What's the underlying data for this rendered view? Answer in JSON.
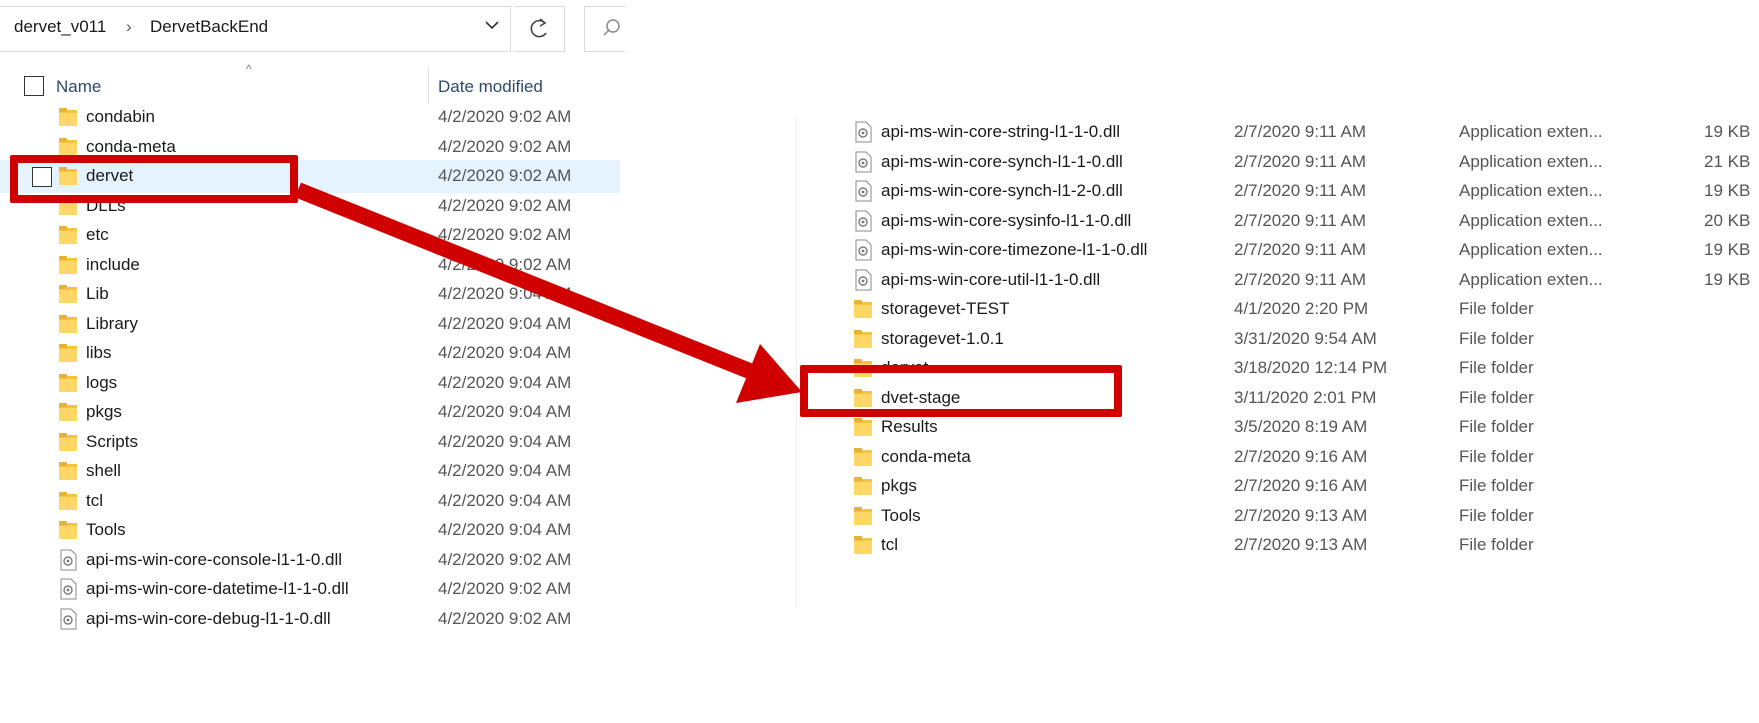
{
  "left": {
    "breadcrumb": [
      "dervet_v011",
      "DervetBackEnd"
    ],
    "breadcrumb_sep": "›",
    "search_icon_glyph": "⚲",
    "refresh_glyph": "↻",
    "dropdown_glyph": "⌄",
    "columns": {
      "name": "Name",
      "date": "Date modified"
    },
    "sort_glyph": "^",
    "rows": [
      {
        "name": "condabin",
        "date": "4/2/2020 9:02 AM",
        "icon": "folder-icon"
      },
      {
        "name": "conda-meta",
        "date": "4/2/2020 9:02 AM",
        "icon": "folder-icon"
      },
      {
        "name": "dervet",
        "date": "4/2/2020 9:02 AM",
        "icon": "folder-icon",
        "selected": true
      },
      {
        "name": "DLLs",
        "date": "4/2/2020 9:02 AM",
        "icon": "folder-icon"
      },
      {
        "name": "etc",
        "date": "4/2/2020 9:02 AM",
        "icon": "folder-icon"
      },
      {
        "name": "include",
        "date": "4/2/2020 9:02 AM",
        "icon": "folder-icon"
      },
      {
        "name": "Lib",
        "date": "4/2/2020 9:04 AM",
        "icon": "folder-icon"
      },
      {
        "name": "Library",
        "date": "4/2/2020 9:04 AM",
        "icon": "folder-icon"
      },
      {
        "name": "libs",
        "date": "4/2/2020 9:04 AM",
        "icon": "folder-icon"
      },
      {
        "name": "logs",
        "date": "4/2/2020 9:04 AM",
        "icon": "folder-icon"
      },
      {
        "name": "pkgs",
        "date": "4/2/2020 9:04 AM",
        "icon": "folder-icon"
      },
      {
        "name": "Scripts",
        "date": "4/2/2020 9:04 AM",
        "icon": "folder-icon"
      },
      {
        "name": "shell",
        "date": "4/2/2020 9:04 AM",
        "icon": "folder-icon"
      },
      {
        "name": "tcl",
        "date": "4/2/2020 9:04 AM",
        "icon": "folder-icon"
      },
      {
        "name": "Tools",
        "date": "4/2/2020 9:04 AM",
        "icon": "folder-icon"
      },
      {
        "name": "api-ms-win-core-console-l1-1-0.dll",
        "date": "4/2/2020 9:02 AM",
        "icon": "dll-file-icon"
      },
      {
        "name": "api-ms-win-core-datetime-l1-1-0.dll",
        "date": "4/2/2020 9:02 AM",
        "icon": "dll-file-icon"
      },
      {
        "name": "api-ms-win-core-debug-l1-1-0.dll",
        "date": "4/2/2020 9:02 AM",
        "icon": "dll-file-icon"
      }
    ]
  },
  "right": {
    "rows": [
      {
        "name": "api-ms-win-core-string-l1-1-0.dll",
        "date": "2/7/2020 9:11 AM",
        "type": "Application exten...",
        "size": "19 KB",
        "icon": "dll-file-icon"
      },
      {
        "name": "api-ms-win-core-synch-l1-1-0.dll",
        "date": "2/7/2020 9:11 AM",
        "type": "Application exten...",
        "size": "21 KB",
        "icon": "dll-file-icon"
      },
      {
        "name": "api-ms-win-core-synch-l1-2-0.dll",
        "date": "2/7/2020 9:11 AM",
        "type": "Application exten...",
        "size": "19 KB",
        "icon": "dll-file-icon"
      },
      {
        "name": "api-ms-win-core-sysinfo-l1-1-0.dll",
        "date": "2/7/2020 9:11 AM",
        "type": "Application exten...",
        "size": "20 KB",
        "icon": "dll-file-icon"
      },
      {
        "name": "api-ms-win-core-timezone-l1-1-0.dll",
        "date": "2/7/2020 9:11 AM",
        "type": "Application exten...",
        "size": "19 KB",
        "icon": "dll-file-icon"
      },
      {
        "name": "api-ms-win-core-util-l1-1-0.dll",
        "date": "2/7/2020 9:11 AM",
        "type": "Application exten...",
        "size": "19 KB",
        "icon": "dll-file-icon"
      },
      {
        "name": "storagevet-TEST",
        "date": "4/1/2020 2:20 PM",
        "type": "File folder",
        "size": "",
        "icon": "folder-icon"
      },
      {
        "name": "storagevet-1.0.1",
        "date": "3/31/2020 9:54 AM",
        "type": "File folder",
        "size": "",
        "icon": "folder-icon"
      },
      {
        "name": "dervet",
        "date": "3/18/2020 12:14 PM",
        "type": "File folder",
        "size": "",
        "icon": "folder-icon"
      },
      {
        "name": "dvet-stage",
        "date": "3/11/2020 2:01 PM",
        "type": "File folder",
        "size": "",
        "icon": "folder-icon"
      },
      {
        "name": "Results",
        "date": "3/5/2020 8:19 AM",
        "type": "File folder",
        "size": "",
        "icon": "folder-icon"
      },
      {
        "name": "conda-meta",
        "date": "2/7/2020 9:16 AM",
        "type": "File folder",
        "size": "",
        "icon": "folder-icon"
      },
      {
        "name": "pkgs",
        "date": "2/7/2020 9:16 AM",
        "type": "File folder",
        "size": "",
        "icon": "folder-icon"
      },
      {
        "name": "Tools",
        "date": "2/7/2020 9:13 AM",
        "type": "File folder",
        "size": "",
        "icon": "folder-icon"
      },
      {
        "name": "tcl",
        "date": "2/7/2020 9:13 AM",
        "type": "File folder",
        "size": "",
        "icon": "folder-icon"
      }
    ]
  },
  "colors": {
    "annotation_red": "#d10000",
    "folder_yellow": "#f5c242",
    "selection_blue": "#e5f3ff"
  }
}
